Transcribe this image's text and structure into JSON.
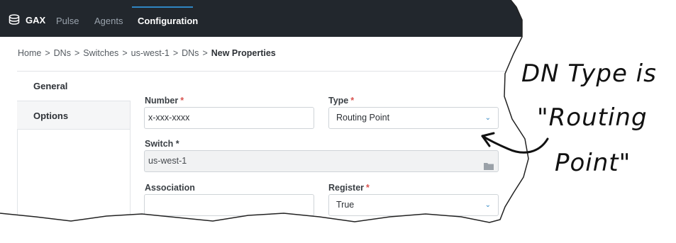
{
  "nav": {
    "brand": "GAX",
    "items": [
      "Pulse",
      "Agents",
      "Configuration"
    ],
    "active_index": 2
  },
  "breadcrumb": {
    "items": [
      "Home",
      "DNs",
      "Switches",
      "us-west-1",
      "DNs"
    ],
    "separator": ">",
    "current": "New Properties"
  },
  "sidebar": {
    "tabs": [
      "General",
      "Options"
    ]
  },
  "form": {
    "number": {
      "label": "Number",
      "value": "x-xxx-xxxx",
      "required_mark": "*"
    },
    "type": {
      "label": "Type",
      "value": "Routing Point",
      "required_mark": "*"
    },
    "switch": {
      "label": "Switch *",
      "value": "us-west-1"
    },
    "association": {
      "label": "Association",
      "value": ""
    },
    "register": {
      "label": "Register",
      "value": "True",
      "required_mark": "*"
    }
  },
  "annotation": {
    "line1": "DN Type is",
    "line2": "\"Routing",
    "line3": "Point\""
  },
  "colors": {
    "topbar": "#22272d",
    "accent": "#2f86c3",
    "required": "#d9534f"
  }
}
